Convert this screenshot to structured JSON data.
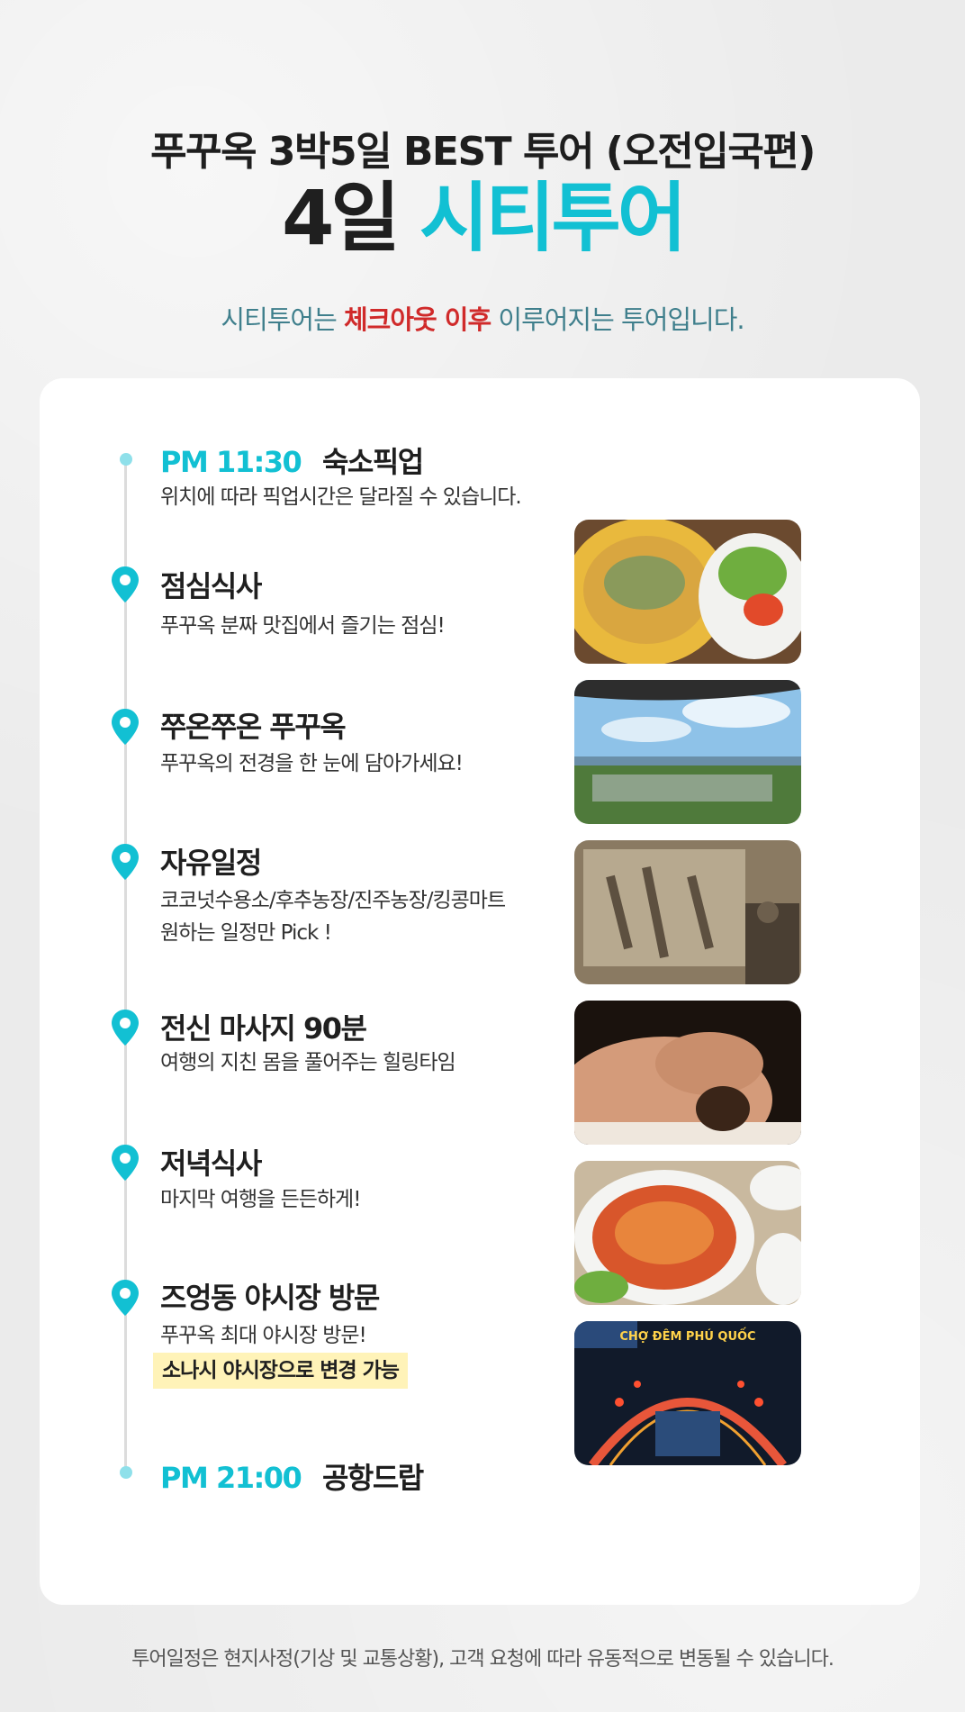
{
  "header": {
    "subtitle": "푸꾸옥 3박5일 BEST 투어 (오전입국편)",
    "title_day": "4일",
    "title_name": "시티투어",
    "notice_prefix": "시티투어는",
    "notice_highlight": "체크아웃 이후",
    "notice_suffix": "이루어지는 투어입니다."
  },
  "schedule": {
    "start": {
      "time": "PM 11:30",
      "label": "숙소픽업",
      "desc": "위치에 따라 픽업시간은 달라질 수 있습니다."
    },
    "stops": [
      {
        "title": "점심식사",
        "desc": "푸꾸옥 분짜 맛집에서 즐기는 점심!"
      },
      {
        "title": "쭈온쭈온 푸꾸옥",
        "desc": "푸꾸옥의 전경을 한 눈에 담아가세요!"
      },
      {
        "title": "자유일정",
        "desc": "코코넛수용소/후추농장/진주농장/킹콩마트",
        "desc2": "원하는 일정만 Pick !"
      },
      {
        "title": "전신 마사지 90분",
        "desc": "여행의 지친 몸을 풀어주는 힐링타임"
      },
      {
        "title": "저녁식사",
        "desc": "마지막 여행을 든든하게!"
      },
      {
        "title": "즈엉동 야시장 방문",
        "desc": "푸꾸옥 최대 야시장 방문!",
        "highlight": "소나시 야시장으로 변경 가능"
      }
    ],
    "end": {
      "time": "PM 21:00",
      "label": "공항드랍"
    }
  },
  "photos": {
    "night_market_sign": "CHỢ ĐÊM PHÚ QUỐC"
  },
  "colors": {
    "accent": "#12c0d3",
    "highlight_red": "#d02a2a",
    "notice": "#3f7f8c",
    "highlight_bg": "#fff3b8"
  },
  "footer": {
    "note": "투어일정은 현지사정(기상 및 교통상황), 고객 요청에 따라 유동적으로 변동될 수 있습니다."
  }
}
